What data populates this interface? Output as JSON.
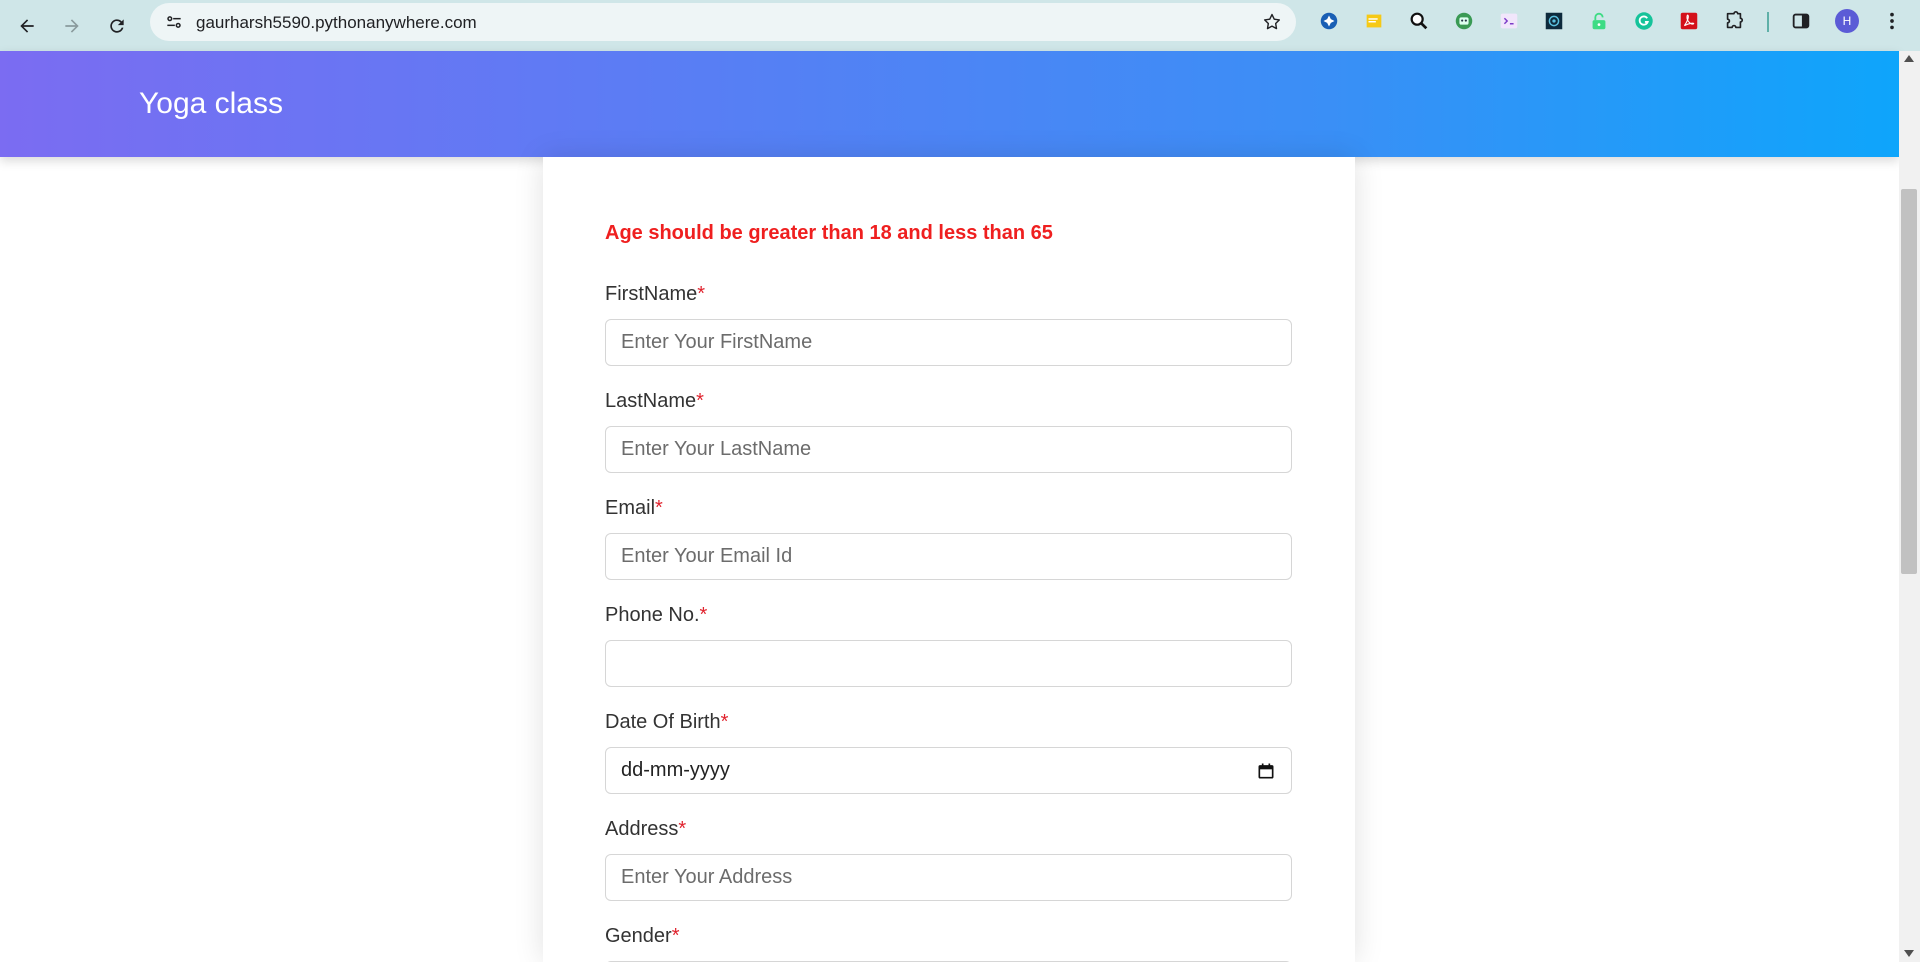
{
  "browser": {
    "url": "gaurharsh5590.pythonanywhere.com",
    "profile_initial": "H",
    "extensions": [
      "extension-icon-1",
      "sticky-note-icon",
      "magnifier-icon",
      "robot-icon",
      "sketch-icon",
      "scanner-icon",
      "lock-icon",
      "grammarly-icon",
      "pdf-icon",
      "puzzle-icon",
      "side-panel-icon"
    ]
  },
  "header": {
    "title": "Yoga class"
  },
  "form": {
    "error_message": "Age should be greater than 18 and less than 65",
    "required_mark": "*",
    "fields": {
      "firstname": {
        "label": "FirstName",
        "placeholder": "Enter Your FirstName"
      },
      "lastname": {
        "label": "LastName",
        "placeholder": "Enter Your LastName"
      },
      "email": {
        "label": "Email",
        "placeholder": "Enter Your Email Id"
      },
      "phone": {
        "label": "Phone No.",
        "placeholder": ""
      },
      "dob": {
        "label": "Date Of Birth",
        "value": "dd-mm-yyyy"
      },
      "address": {
        "label": "Address",
        "placeholder": "Enter Your Address"
      },
      "gender": {
        "label": "Gender"
      }
    }
  },
  "colors": {
    "header_gradient_start": "#7b6cf2",
    "header_gradient_end": "#0ea5fb",
    "error": "#ef1f1f",
    "required": "#e0222d"
  }
}
